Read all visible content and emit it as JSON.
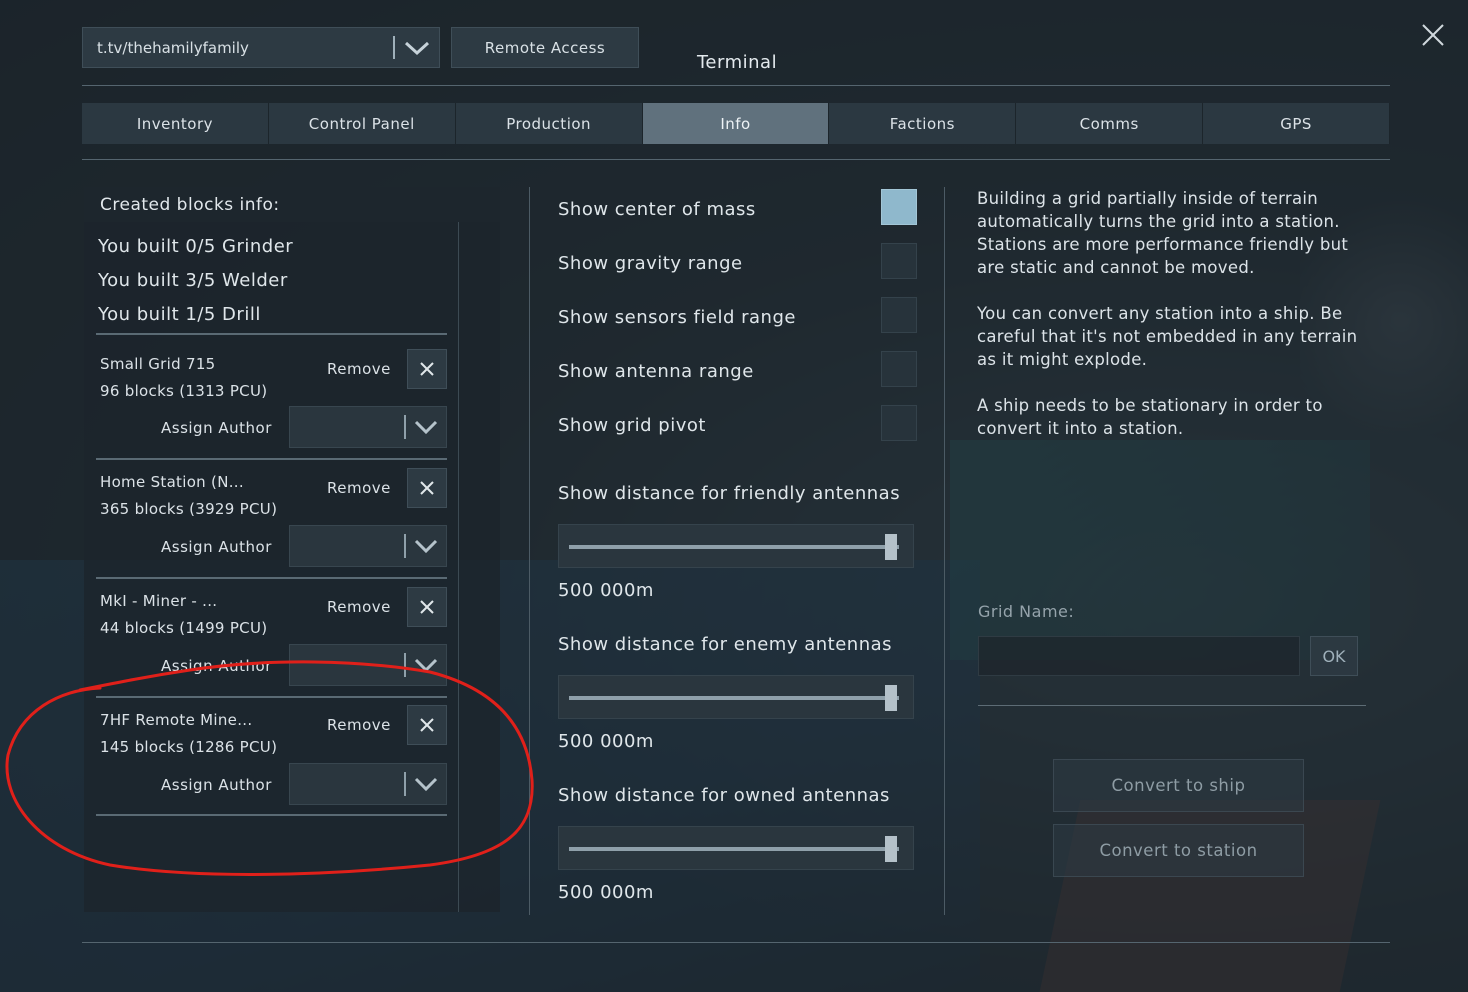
{
  "top_bar": {
    "player_dropdown_value": "t.tv/thehamilyfamily",
    "remote_access_label": "Remote Access",
    "terminal_title": "Terminal"
  },
  "tabs": [
    {
      "label": "Inventory",
      "active": false
    },
    {
      "label": "Control Panel",
      "active": false
    },
    {
      "label": "Production",
      "active": false
    },
    {
      "label": "Info",
      "active": true
    },
    {
      "label": "Factions",
      "active": false
    },
    {
      "label": "Comms",
      "active": false
    },
    {
      "label": "GPS",
      "active": false
    }
  ],
  "created_blocks": {
    "header": "Created blocks info:",
    "built_lines": [
      "You built 0/5 Grinder",
      "You built 3/5 Welder",
      "You built 1/5 Drill"
    ],
    "remove_label": "Remove",
    "assign_author_label": "Assign Author",
    "grids": [
      {
        "name": "Small Grid 715",
        "blocks": "96 blocks (1313 PCU)"
      },
      {
        "name": "Home Station (N...",
        "blocks": "365 blocks (3929 PCU)"
      },
      {
        "name": "MkI - Miner  - ...",
        "blocks": "44 blocks (1499 PCU)"
      },
      {
        "name": "7HF Remote Mine...",
        "blocks": "145 blocks (1286 PCU)"
      }
    ]
  },
  "options": {
    "show_center_of_mass": {
      "label": "Show center of mass",
      "checked": true
    },
    "show_gravity_range": {
      "label": "Show gravity range",
      "checked": false
    },
    "show_sensors_field_range": {
      "label": "Show sensors field range",
      "checked": false
    },
    "show_antenna_range": {
      "label": "Show antenna range",
      "checked": false
    },
    "show_grid_pivot": {
      "label": "Show grid pivot",
      "checked": false
    }
  },
  "sliders": {
    "friendly": {
      "label": "Show distance for friendly antennas",
      "value": "500 000m",
      "fraction": 1.0
    },
    "enemy": {
      "label": "Show distance for enemy antennas",
      "value": "500 000m",
      "fraction": 1.0
    },
    "owned": {
      "label": "Show distance for owned antennas",
      "value": "500 000m",
      "fraction": 1.0
    }
  },
  "info_text": {
    "p1": "Building a grid partially inside of terrain automatically turns the grid into a station. Stations are more performance friendly but are static and cannot be moved.",
    "p2": "You can convert any station into a ship. Be careful that it's not embedded in any terrain as it might explode.",
    "p3": "A ship needs to be stationary in order to convert it into a station."
  },
  "grid_name": {
    "label": "Grid Name:",
    "value": "",
    "ok_label": "OK"
  },
  "convert_to_ship_label": "Convert to ship",
  "convert_to_station_label": "Convert to station",
  "colors": {
    "active_tab": "#60717d",
    "checkbox_checked": "#8fb8cc",
    "annotation_red": "#e0201a"
  }
}
